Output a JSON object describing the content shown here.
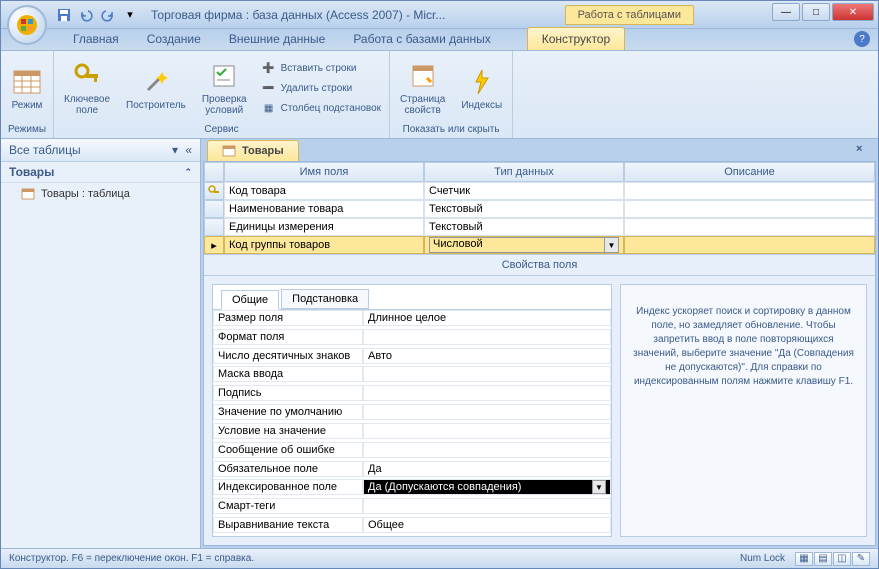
{
  "title": "Торговая фирма : база данных (Access 2007) - Micr...",
  "context_tab_group": "Работа с таблицами",
  "tabs": [
    "Главная",
    "Создание",
    "Внешние данные",
    "Работа с базами данных"
  ],
  "context_tab": "Конструктор",
  "ribbon": {
    "g1": {
      "label": "Режимы",
      "btn": "Режим"
    },
    "g2": {
      "label": "Сервис",
      "key": "Ключевое\nполе",
      "builder": "Построитель",
      "validate": "Проверка\nусловий",
      "insert_rows": "Вставить строки",
      "delete_rows": "Удалить строки",
      "lookup_col": "Столбец подстановок"
    },
    "g3": {
      "label": "Показать или скрыть",
      "propsheet": "Страница\nсвойств",
      "indexes": "Индексы"
    }
  },
  "nav": {
    "header": "Все таблицы",
    "group": "Товары",
    "item": "Товары : таблица"
  },
  "doc_tab": "Товары",
  "columns": {
    "name": "Имя поля",
    "type": "Тип данных",
    "desc": "Описание"
  },
  "rows": [
    {
      "name": "Код товара",
      "type": "Счетчик",
      "pk": true
    },
    {
      "name": "Наименование товара",
      "type": "Текстовый"
    },
    {
      "name": "Единицы измерения",
      "type": "Текстовый"
    },
    {
      "name": "Код группы товаров",
      "type": "Числовой",
      "selected": true
    }
  ],
  "prop_section": "Свойства поля",
  "prop_tabs": {
    "general": "Общие",
    "lookup": "Подстановка"
  },
  "props": [
    {
      "l": "Размер поля",
      "v": "Длинное целое"
    },
    {
      "l": "Формат поля",
      "v": ""
    },
    {
      "l": "Число десятичных знаков",
      "v": "Авто"
    },
    {
      "l": "Маска ввода",
      "v": ""
    },
    {
      "l": "Подпись",
      "v": ""
    },
    {
      "l": "Значение по умолчанию",
      "v": ""
    },
    {
      "l": "Условие на значение",
      "v": ""
    },
    {
      "l": "Сообщение об ошибке",
      "v": ""
    },
    {
      "l": "Обязательное поле",
      "v": "Да"
    },
    {
      "l": "Индексированное поле",
      "v": "Да (Допускаются совпадения)",
      "sel": true
    },
    {
      "l": "Смарт-теги",
      "v": ""
    },
    {
      "l": "Выравнивание текста",
      "v": "Общее"
    }
  ],
  "help_text": "Индекс ускоряет поиск и сортировку в данном поле, но замедляет обновление. Чтобы запретить ввод в поле повторяющихся значений, выберите значение \"Да (Совпадения не допускаются)\". Для справки по индексированным полям нажмите клавишу F1.",
  "status": {
    "left": "Конструктор.  F6 = переключение окон.  F1 = справка.",
    "numlock": "Num Lock"
  }
}
